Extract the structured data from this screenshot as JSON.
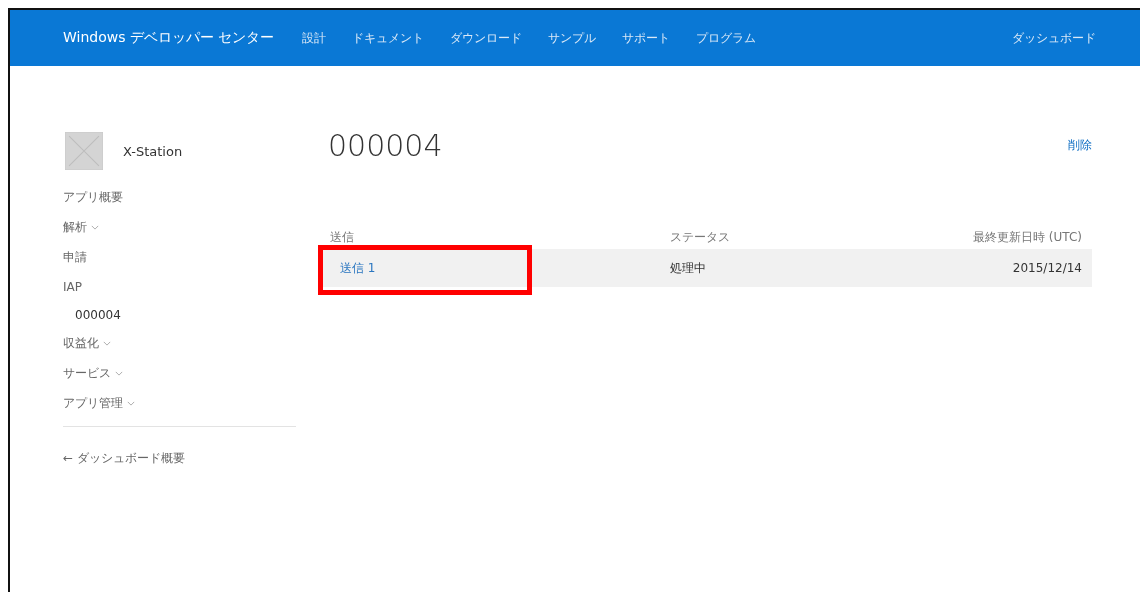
{
  "header": {
    "brand": "Windows デベロッパー センター",
    "nav": [
      {
        "label": "設計"
      },
      {
        "label": "ドキュメント"
      },
      {
        "label": "ダウンロード"
      },
      {
        "label": "サンプル"
      },
      {
        "label": "サポート"
      },
      {
        "label": "プログラム"
      }
    ],
    "dashboard": "ダッシュボード"
  },
  "sidebar": {
    "app_name": "X-Station",
    "items": [
      {
        "label": "アプリ概要",
        "has_menu": false
      },
      {
        "label": "解析",
        "has_menu": true
      },
      {
        "label": "申請",
        "has_menu": false
      },
      {
        "label": "IAP",
        "has_menu": false,
        "children": [
          {
            "label": "000004"
          }
        ]
      },
      {
        "label": "収益化",
        "has_menu": true
      },
      {
        "label": "サービス",
        "has_menu": true
      },
      {
        "label": "アプリ管理",
        "has_menu": true
      }
    ],
    "back_link": "← ダッシュボード概要"
  },
  "main": {
    "title": "000004",
    "delete": "削除",
    "table": {
      "columns": [
        "送信",
        "ステータス",
        "最終更新日時 (UTC)"
      ],
      "rows": [
        {
          "submission": "送信 1",
          "status": "処理中",
          "updated": "2015/12/14",
          "highlighted": true
        }
      ]
    }
  }
}
